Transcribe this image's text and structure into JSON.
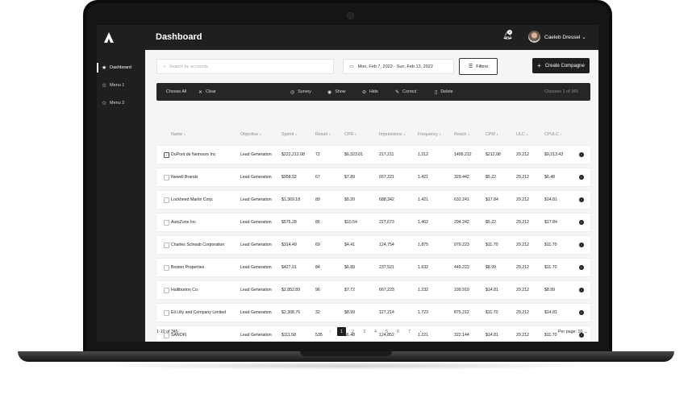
{
  "sidebar": {
    "items": [
      {
        "label": "Dashboard",
        "icon": "star-filled-icon",
        "active": true
      },
      {
        "label": "Menu 1",
        "icon": "star-outline-icon",
        "active": false
      },
      {
        "label": "Menu 2",
        "icon": "star-outline-icon",
        "active": false
      }
    ]
  },
  "header": {
    "title": "Dashboard",
    "notification_count": "2",
    "user_name": "Caeleb Dressel"
  },
  "controls": {
    "search_placeholder": "Search by accounts",
    "date_range": "Mon, Feb 7, 2022 - Sun, Feb 13, 2022",
    "filters_label": "Filters",
    "create_label": "Create Compagne"
  },
  "toolbar": {
    "choose_all": "Choose All",
    "clear": "Clear",
    "survey": "Survey",
    "show": "Show",
    "hide": "Hide",
    "correct": "Correct",
    "delete": "Delete",
    "chosen": "Choosen 1 of 345"
  },
  "columns": [
    "Name",
    "Objective",
    "Spend",
    "Result",
    "CPR",
    "Impressions",
    "Frequency",
    "Reach",
    "CPM",
    "ULC",
    "CPULC"
  ],
  "rows": [
    {
      "name": "DuPont de Nemours Inc",
      "objective": "Lead Generation",
      "spend": "$222,212.08",
      "result": "72",
      "cpr": "$6,323.01",
      "impressions": "217,211",
      "frequency": "1.212",
      "reach": "1499.212",
      "cpm": "$212.08",
      "ulc": "29,212",
      "cpulc": "$9,213.43",
      "checked": true
    },
    {
      "name": "Newell Brands",
      "objective": "Lead Generation",
      "spend": "$958.52",
      "result": "67",
      "cpr": "$7.89",
      "impressions": "657,221",
      "frequency": "1.421",
      "reach": "329.442",
      "cpm": "$5.22",
      "ulc": "29,212",
      "cpulc": "$6.48",
      "checked": false
    },
    {
      "name": "Lockheed Martin Corp.",
      "objective": "Lead Generation",
      "spend": "$1,369.18",
      "result": "89",
      "cpr": "$5.20",
      "impressions": "688,342",
      "frequency": "1.421",
      "reach": "632.241",
      "cpm": "$17.84",
      "ulc": "29,212",
      "cpulc": "$14.81",
      "checked": false
    },
    {
      "name": "AutoZone Inc",
      "objective": "Lead Generation",
      "spend": "$575.28",
      "result": "85",
      "cpr": "$10.54",
      "impressions": "227,673",
      "frequency": "1.462",
      "reach": "294.242",
      "cpm": "$5.22",
      "ulc": "29,212",
      "cpulc": "$17.84",
      "checked": false
    },
    {
      "name": "Charles Schwab Corporation",
      "objective": "Lead Generation",
      "spend": "$314.49",
      "result": "69",
      "cpr": "$4.41",
      "impressions": "124,754",
      "frequency": "1.875",
      "reach": "979.223",
      "cpm": "$11.70",
      "ulc": "29,212",
      "cpulc": "$11.70",
      "checked": false
    },
    {
      "name": "Boston Properties",
      "objective": "Lead Generation",
      "spend": "$427.01",
      "result": "84",
      "cpr": "$6.89",
      "impressions": "237,521",
      "frequency": "1.632",
      "reach": "449.222",
      "cpm": "$8.99",
      "ulc": "29,212",
      "cpulc": "$11.70",
      "checked": false
    },
    {
      "name": "Halliburton Co.",
      "objective": "Lead Generation",
      "spend": "$2,852.89",
      "result": "96",
      "cpr": "$7.72",
      "impressions": "667,223",
      "frequency": "1.232",
      "reach": "199.919",
      "cpm": "$14.81",
      "ulc": "29,212",
      "cpulc": "$8.99",
      "checked": false
    },
    {
      "name": "Eli Lilly and Company Limited",
      "objective": "Lead Generation",
      "spend": "$2,308.76",
      "result": "32",
      "cpr": "$8.99",
      "impressions": "127,214",
      "frequency": "1.723",
      "reach": "875.212",
      "cpm": "$11.70",
      "ulc": "29,212",
      "cpulc": "$14.81",
      "checked": false
    },
    {
      "name": "SANOFI",
      "objective": "Lead Generation",
      "spend": "$111.58",
      "result": "535",
      "cpr": "$6.48",
      "impressions": "124,852",
      "frequency": "1.221",
      "reach": "322.144",
      "cpm": "$14.81",
      "ulc": "29,212",
      "cpulc": "$11.70",
      "checked": false
    }
  ],
  "footer": {
    "range": "1-10 of 345",
    "pages": [
      "1",
      "2",
      "3",
      "4",
      "5",
      "6",
      "7"
    ],
    "per_page": "Per page: 10"
  }
}
